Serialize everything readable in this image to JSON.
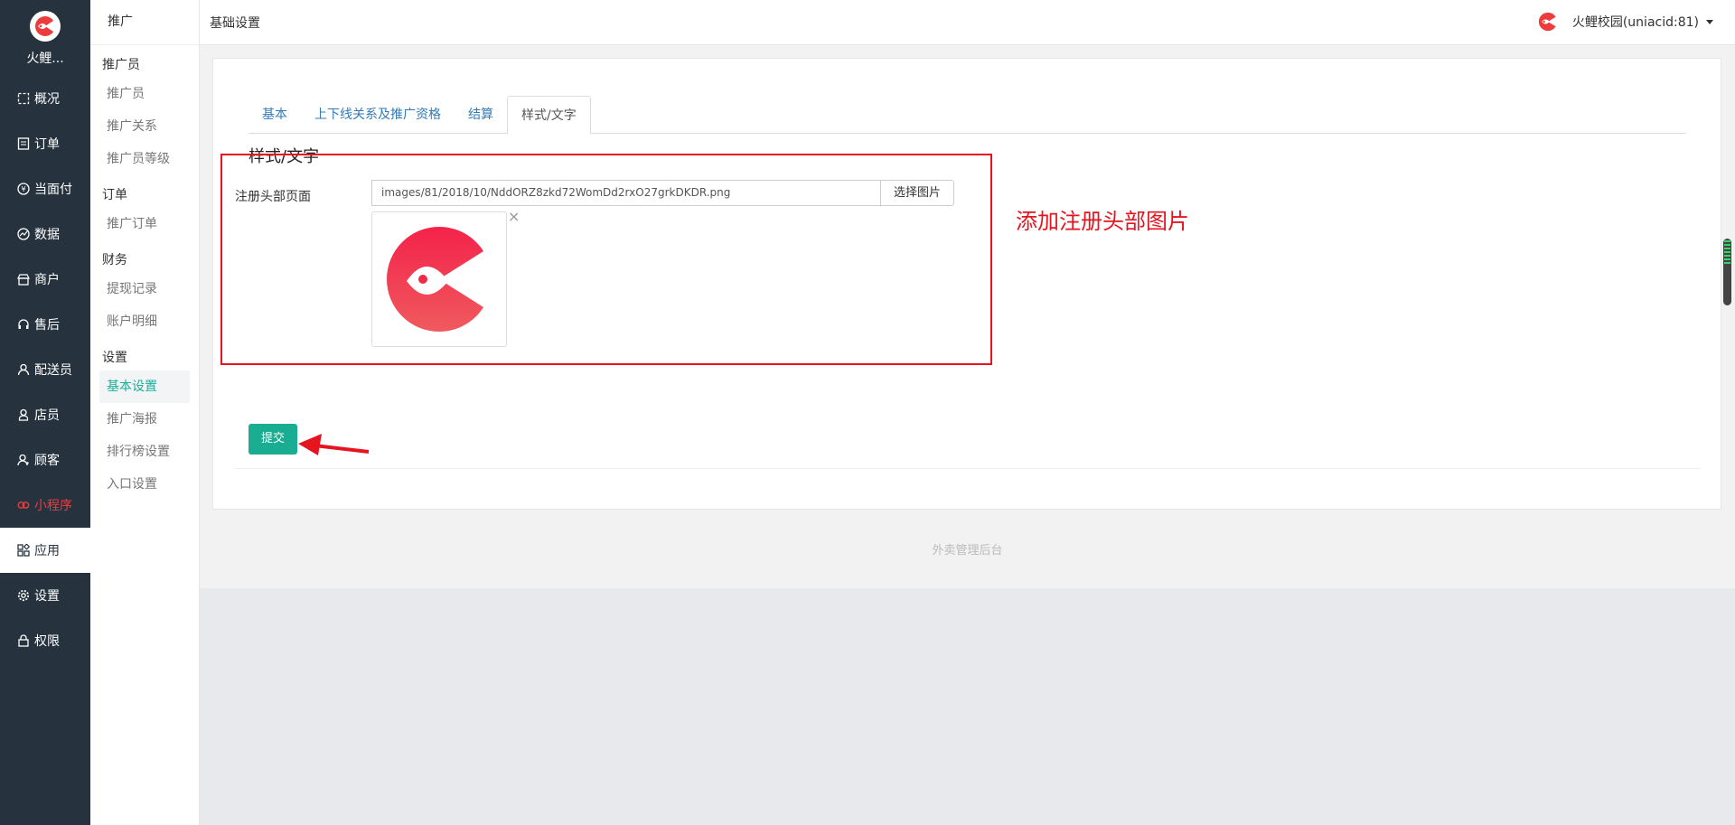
{
  "sidebar": {
    "app_name": "火鲤...",
    "items": [
      {
        "label": "概况",
        "icon": "dashboard-icon"
      },
      {
        "label": "订单",
        "icon": "order-list-icon"
      },
      {
        "label": "当面付",
        "icon": "yen-icon"
      },
      {
        "label": "数据",
        "icon": "chart-icon"
      },
      {
        "label": "商户",
        "icon": "store-icon"
      },
      {
        "label": "售后",
        "icon": "headset-icon"
      },
      {
        "label": "配送员",
        "icon": "courier-icon"
      },
      {
        "label": "店员",
        "icon": "clerk-icon"
      },
      {
        "label": "顾客",
        "icon": "customer-icon"
      },
      {
        "label": "小程序",
        "icon": "miniprogram-icon"
      },
      {
        "label": "应用",
        "icon": "apps-icon"
      },
      {
        "label": "设置",
        "icon": "gear-icon"
      },
      {
        "label": "权限",
        "icon": "lock-icon"
      }
    ]
  },
  "subnav": {
    "title": "推广",
    "groups": [
      {
        "title": "推广员",
        "items": [
          "推广员",
          "推广关系",
          "推广员等级"
        ]
      },
      {
        "title": "订单",
        "items": [
          "推广订单"
        ]
      },
      {
        "title": "财务",
        "items": [
          "提现记录",
          "账户明细"
        ]
      },
      {
        "title": "设置",
        "items": [
          "基本设置",
          "推广海报",
          "排行榜设置",
          "入口设置"
        ]
      }
    ]
  },
  "header": {
    "title": "基础设置",
    "user": "火鲤校园(uniacid:81)"
  },
  "tabs": [
    "基本",
    "上下线关系及推广资格",
    "结算",
    "样式/文字"
  ],
  "form": {
    "section_title": "样式/文字",
    "label": "注册头部页面",
    "image_path": "images/81/2018/10/NddORZ8zkd72WomDd2rxO27grkDKDR.png",
    "pick_button": "选择图片",
    "remove_glyph": "×",
    "submit": "提交"
  },
  "footer": "外卖管理后台",
  "annotation": {
    "text": "添加注册头部图片"
  },
  "colors": {
    "sidebar_bg": "#26333f",
    "accent_green": "#1aad91",
    "brand_red": "#ee3b3b",
    "annotation_red": "#e5141f"
  }
}
